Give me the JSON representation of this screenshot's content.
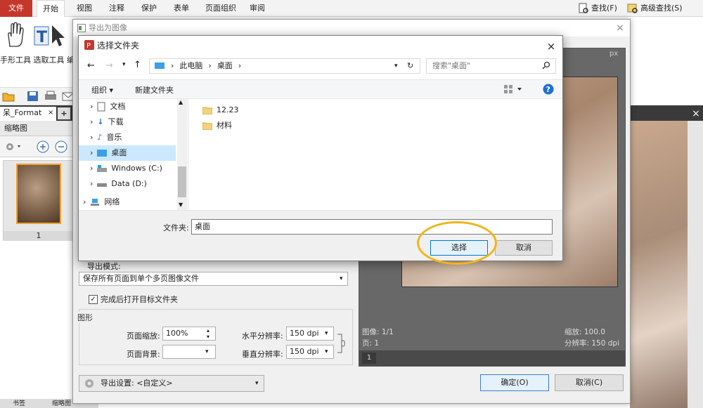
{
  "ribbon": {
    "tabs": [
      "文件",
      "开始",
      "视图",
      "注释",
      "保护",
      "表单",
      "页面组织",
      "审阅"
    ],
    "find_label": "查找(F)",
    "advanced_find_label": "高级查找(S)",
    "tool_labels": "手形工具 选取工具 编"
  },
  "doc_tab": {
    "title": "呆_Format",
    "close": "×",
    "plus": "+"
  },
  "thumb_panel": {
    "title": "缩略图",
    "page_number": "1"
  },
  "bottom_tabs": [
    "书签",
    "缩略图"
  ],
  "doc_close": "×",
  "export_dialog": {
    "title": "导出为图像",
    "close": "×",
    "mode_label": "导出模式:",
    "mode_value": "保存所有页面到单个多页图像文件",
    "open_folder_label": "完成后打开目标文件夹",
    "open_folder_checked": true,
    "graphics_label": "图形",
    "page_scale_label": "页面缩放:",
    "page_scale_value": "100%",
    "page_bg_label": "页面背景:",
    "h_res_label": "水平分辨率:",
    "h_res_value": "150 dpi",
    "v_res_label": "垂直分辨率:",
    "v_res_value": "150 dpi",
    "settings_label": "导出设置:",
    "settings_value": "<自定义>",
    "ok_label": "确定(O)",
    "cancel_label": "取消(C)",
    "preview": {
      "unit": "px",
      "image_info": "图像: 1/1",
      "page_info": "页: 1",
      "zoom_info": "缩放: 100.0",
      "res_info": "分辨率: 150 dpi",
      "page_box": "1"
    }
  },
  "folder_dialog": {
    "title": "选择文件夹",
    "close": "×",
    "breadcrumb": [
      "此电脑",
      "桌面"
    ],
    "search_placeholder": "搜索\"桌面\"",
    "organize_label": "组织 ▾",
    "new_folder_label": "新建文件夹",
    "nav_items": [
      "文档",
      "下载",
      "音乐",
      "桌面",
      "Windows (C:)",
      "Data (D:)",
      "网络"
    ],
    "selected_nav": "桌面",
    "files": [
      "12.23",
      "材料"
    ],
    "folder_label": "文件夹:",
    "folder_value": "桌面",
    "select_label": "选择",
    "cancel_label": "取消"
  },
  "colors": {
    "accent_red": "#c5372b",
    "highlight_circle": "#f2b519",
    "nav_selected": "#cce8ff"
  }
}
